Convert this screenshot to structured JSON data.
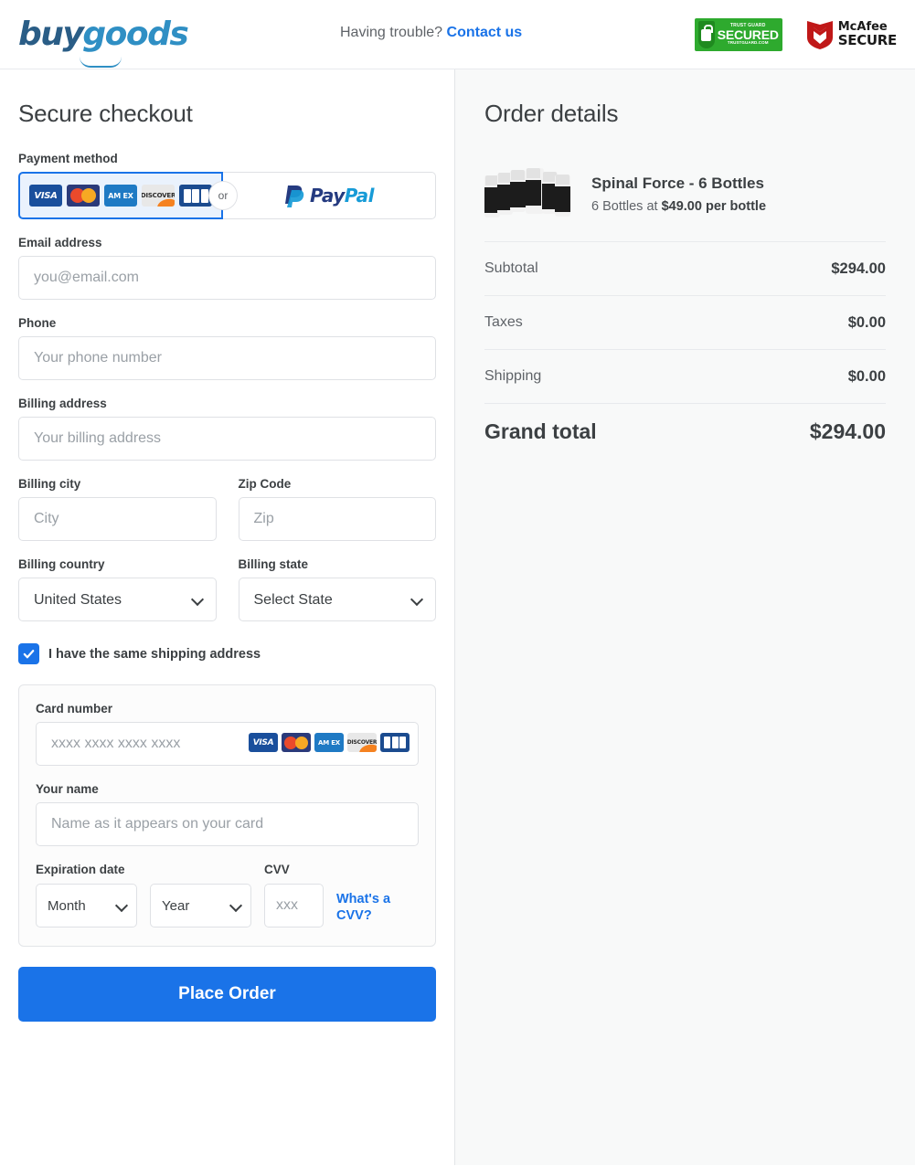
{
  "header": {
    "logo_buy": "buy",
    "logo_goods": "goods",
    "help_text": "Having trouble?",
    "contact_link": "Contact us",
    "trustguard": {
      "top": "TRUST GUARD",
      "mid": "SECURED",
      "bottom": "TRUSTGUARD.COM"
    },
    "mcafee": {
      "line1": "McAfee",
      "line2": "SECURE"
    }
  },
  "checkout": {
    "title": "Secure checkout",
    "payment_method_label": "Payment method",
    "or_label": "or",
    "paypal_pay": "Pay",
    "paypal_pal": "Pal",
    "card_brands": [
      "VISA",
      "Mastercard",
      "AM EX",
      "DISCOVER",
      "JCB"
    ],
    "email": {
      "label": "Email address",
      "value": "",
      "placeholder": "you@email.com"
    },
    "phone": {
      "label": "Phone",
      "value": "",
      "placeholder": "Your phone number"
    },
    "billing_address": {
      "label": "Billing address",
      "value": "",
      "placeholder": "Your billing address"
    },
    "billing_city": {
      "label": "Billing city",
      "value": "",
      "placeholder": "City"
    },
    "zip": {
      "label": "Zip Code",
      "value": "",
      "placeholder": "Zip"
    },
    "billing_country": {
      "label": "Billing country",
      "selected": "United States"
    },
    "billing_state": {
      "label": "Billing state",
      "selected": "Select State"
    },
    "same_shipping": {
      "label": "I have the same shipping address",
      "checked": true
    },
    "card_number": {
      "label": "Card number",
      "value": "",
      "placeholder": "xxxx xxxx xxxx xxxx"
    },
    "card_name": {
      "label": "Your name",
      "value": "",
      "placeholder": "Name as it appears on your card"
    },
    "expiration": {
      "label": "Expiration date",
      "month": "Month",
      "year": "Year"
    },
    "cvv": {
      "label": "CVV",
      "value": "",
      "placeholder": "xxx",
      "help_link": "What's a CVV?"
    },
    "place_order": "Place Order"
  },
  "order": {
    "title": "Order details",
    "product_name": "Spinal Force - 6 Bottles",
    "product_qty_text": "6 Bottles at ",
    "product_price_text": "$49.00 per bottle",
    "rows": [
      {
        "key": "Subtotal",
        "value": "$294.00"
      },
      {
        "key": "Taxes",
        "value": "$0.00"
      },
      {
        "key": "Shipping",
        "value": "$0.00"
      }
    ],
    "grand_label": "Grand total",
    "grand_value": "$294.00"
  },
  "colors": {
    "accent": "#1a73e8",
    "panel": "#f8f9f9",
    "trust_green": "#2eaa2e",
    "mcafee_red": "#c01818"
  }
}
